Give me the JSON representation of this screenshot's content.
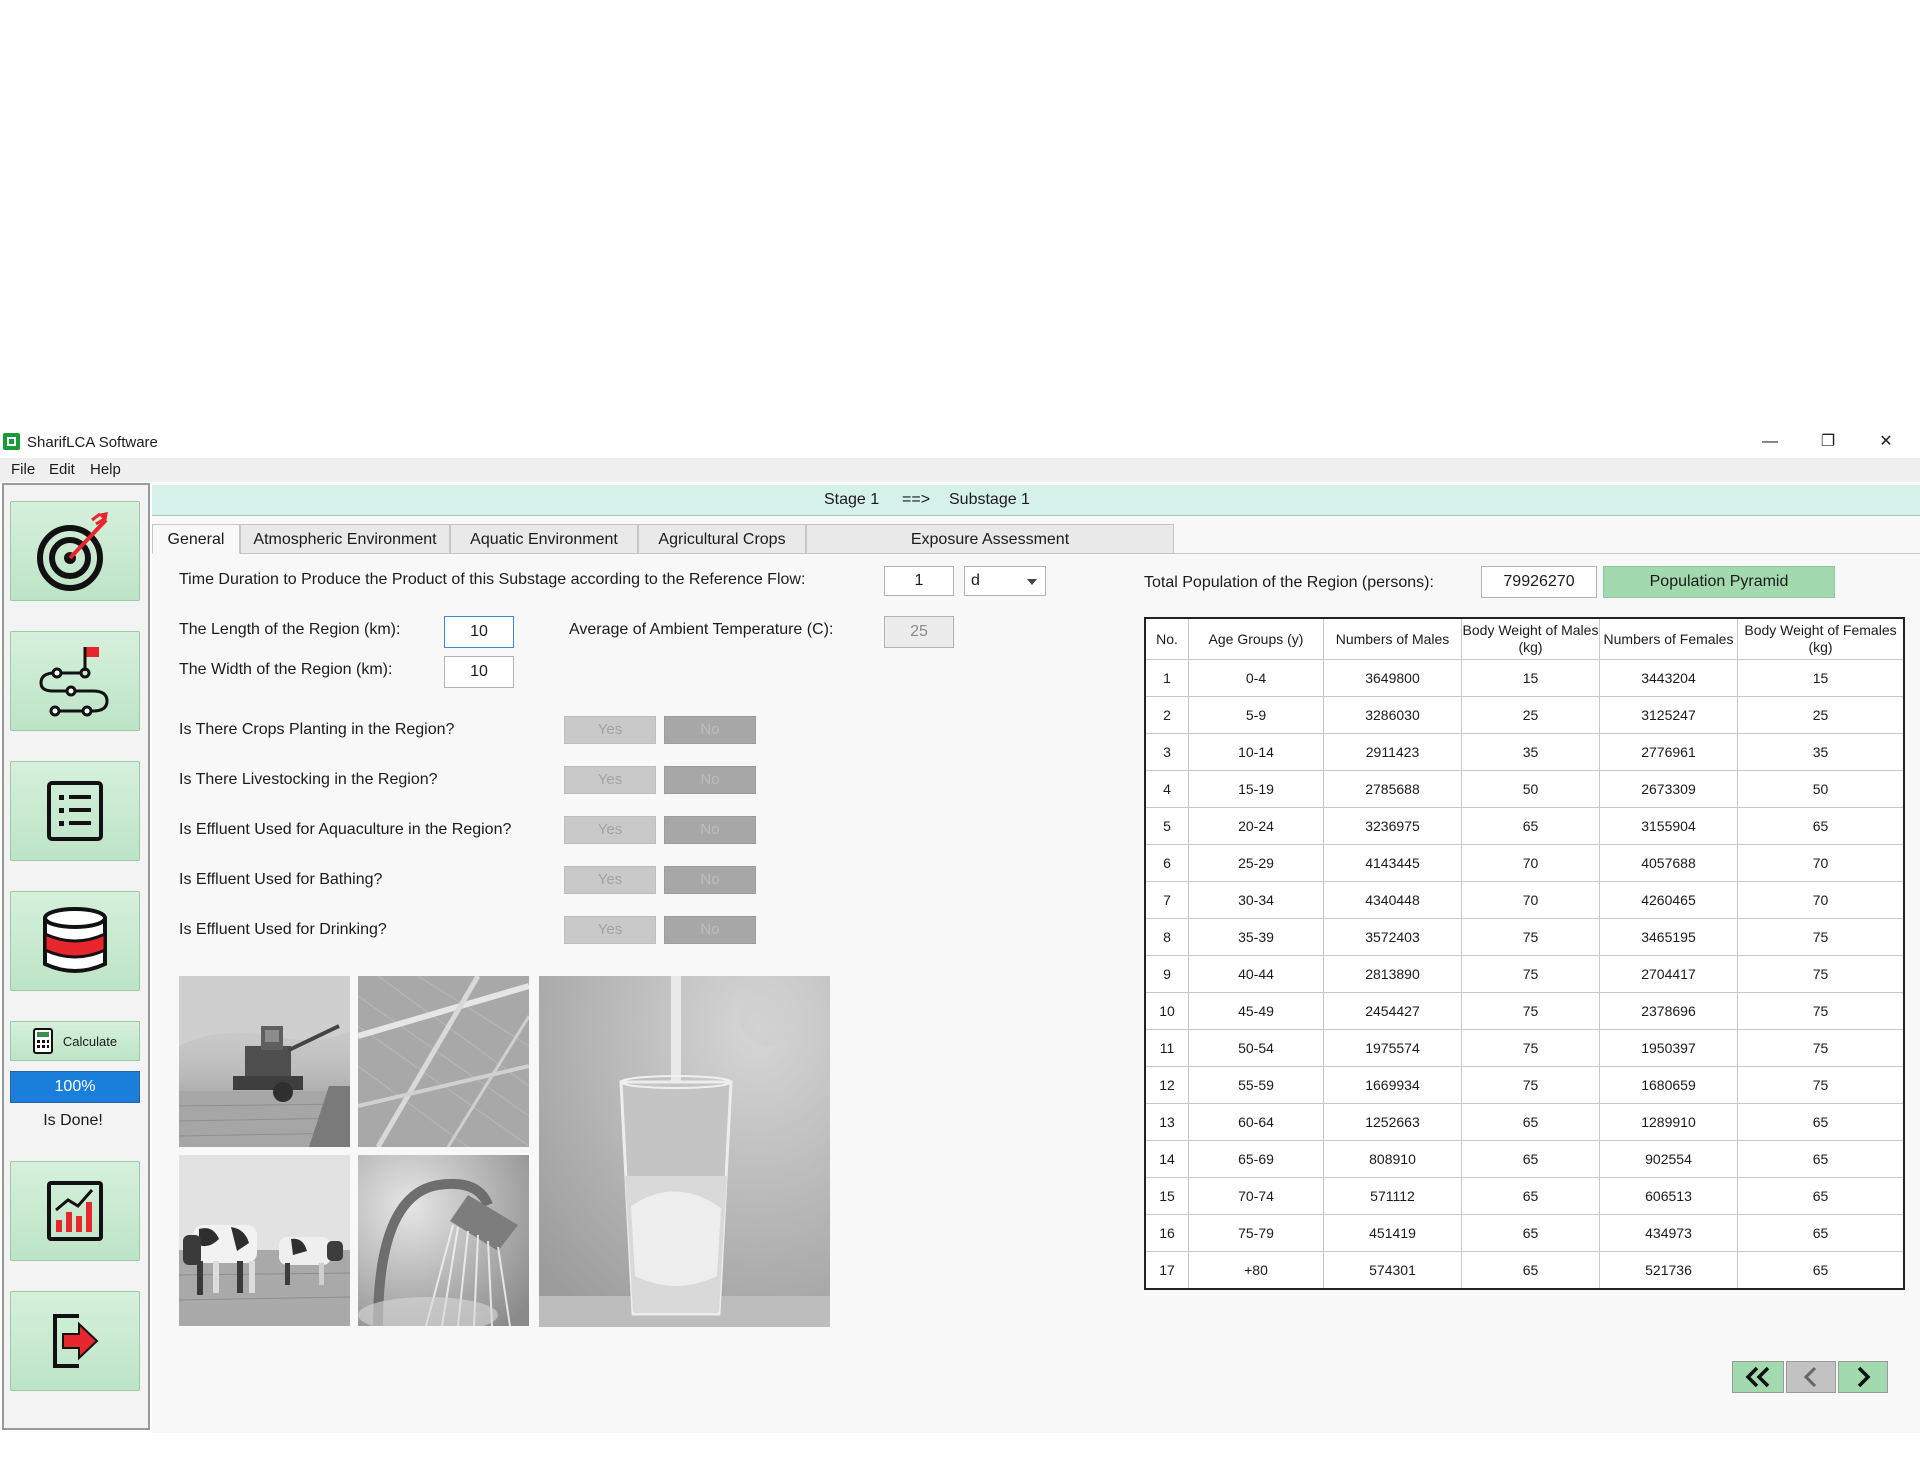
{
  "window": {
    "title": "SharifLCA Software",
    "controls": {
      "minimize": "—",
      "maximize": "❐",
      "close": "✕"
    }
  },
  "menu": [
    "File",
    "Edit",
    "Help"
  ],
  "sidebar": {
    "icons": [
      "target-icon",
      "route-icon",
      "list-icon",
      "database-icon",
      "chart-icon",
      "exit-icon"
    ],
    "calculate_label": "Calculate",
    "progress": "100%",
    "progress_value": 100,
    "status": "Is Done!"
  },
  "stage_bar": {
    "stage": "Stage 1",
    "arrow": "==>",
    "substage": "Substage 1"
  },
  "tabs": [
    "General",
    "Atmospheric Environment",
    "Aquatic Environment",
    "Agricultural Crops",
    "Exposure Assessment"
  ],
  "active_tab": "General",
  "form": {
    "time_label": "Time Duration to Produce the Product of this Substage according to the Reference Flow:",
    "time_value": "1",
    "time_unit": "d",
    "length_label": "The Length of the Region (km):",
    "length_value": "10",
    "width_label": "The Width of the Region (km):",
    "width_value": "10",
    "temp_label": "Average of Ambient Temperature (C):",
    "temp_value": "25",
    "yes_label": "Yes",
    "no_label": "No",
    "questions": [
      "Is There Crops Planting in the Region?",
      "Is There Livestocking in the Region?",
      "Is Effluent Used for Aquaculture in the Region?",
      "Is Effluent Used for Bathing?",
      "Is Effluent Used for Drinking?"
    ]
  },
  "population": {
    "label": "Total Population of the Region (persons):",
    "value": "79926270",
    "pyramid_button": "Population Pyramid"
  },
  "table": {
    "headers": [
      "No.",
      "Age Groups (y)",
      "Numbers of Males",
      "Body Weight of Males (kg)",
      "Numbers of Females",
      "Body Weight of Females (kg)"
    ],
    "rows": [
      [
        "1",
        "0-4",
        "3649800",
        "15",
        "3443204",
        "15"
      ],
      [
        "2",
        "5-9",
        "3286030",
        "25",
        "3125247",
        "25"
      ],
      [
        "3",
        "10-14",
        "2911423",
        "35",
        "2776961",
        "35"
      ],
      [
        "4",
        "15-19",
        "2785688",
        "50",
        "2673309",
        "50"
      ],
      [
        "5",
        "20-24",
        "3236975",
        "65",
        "3155904",
        "65"
      ],
      [
        "6",
        "25-29",
        "4143445",
        "70",
        "4057688",
        "70"
      ],
      [
        "7",
        "30-34",
        "4340448",
        "70",
        "4260465",
        "70"
      ],
      [
        "8",
        "35-39",
        "3572403",
        "75",
        "3465195",
        "75"
      ],
      [
        "9",
        "40-44",
        "2813890",
        "75",
        "2704417",
        "75"
      ],
      [
        "10",
        "45-49",
        "2454427",
        "75",
        "2378696",
        "75"
      ],
      [
        "11",
        "50-54",
        "1975574",
        "75",
        "1950397",
        "75"
      ],
      [
        "12",
        "55-59",
        "1669934",
        "75",
        "1680659",
        "75"
      ],
      [
        "13",
        "60-64",
        "1252663",
        "65",
        "1289910",
        "65"
      ],
      [
        "14",
        "65-69",
        "808910",
        "65",
        "902554",
        "65"
      ],
      [
        "15",
        "70-74",
        "571112",
        "65",
        "606513",
        "65"
      ],
      [
        "16",
        "75-79",
        "451419",
        "65",
        "434973",
        "65"
      ],
      [
        "17",
        "+80",
        "574301",
        "65",
        "521736",
        "65"
      ]
    ]
  },
  "images": [
    "harvester-field-image",
    "irrigation-crops-image",
    "cows-pasture-image",
    "shower-head-image",
    "water-glass-image"
  ],
  "colors": {
    "accent_green": "#a3d9ae",
    "stage_bar": "#d6f0ea",
    "progress_blue": "#1a7fdb",
    "icon_red": "#e8262d"
  }
}
